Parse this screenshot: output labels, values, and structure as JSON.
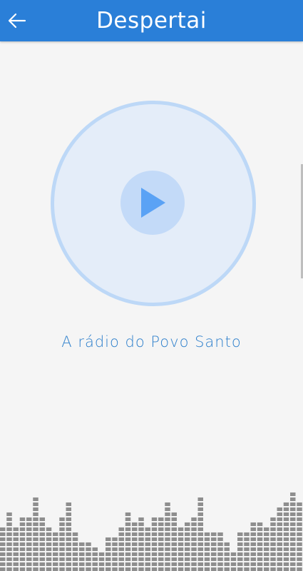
{
  "app_bar": {
    "title": "Despertai",
    "back_icon": "arrow-left-icon",
    "color": "#2a7fd8"
  },
  "player": {
    "play_icon": "play-icon",
    "station_label": "A rádio do Povo Santo",
    "accent": "#5aa2f5"
  },
  "visualizer": {
    "icon": "audio-spectrum",
    "bar_color": "#8e8e8e",
    "levels": [
      0.51,
      0.66,
      0.51,
      0.57,
      0.6,
      0.82,
      0.6,
      0.49,
      0.43,
      0.59,
      0.73,
      0.42,
      0.3,
      0.31,
      0.26,
      0.2,
      0.36,
      0.37,
      0.51,
      0.62,
      0.56,
      0.6,
      0.5,
      0.61,
      0.61,
      0.78,
      0.66,
      0.48,
      0.55,
      0.57,
      0.81,
      0.42,
      0.42,
      0.44,
      0.3,
      0.21,
      0.41,
      0.43,
      0.53,
      0.55,
      0.51,
      0.6,
      0.72,
      0.78,
      0.84,
      0.75
    ]
  }
}
